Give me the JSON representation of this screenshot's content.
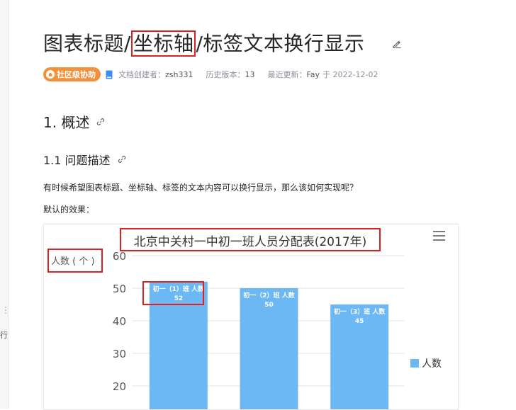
{
  "sidebar": {
    "handle": "⋮",
    "fragment": "行"
  },
  "page": {
    "title_pre": "图表标题/",
    "title_hl": "坐标轴",
    "title_post": "/标签文本换行显示"
  },
  "meta": {
    "badge": "社区级协助",
    "creator_label": "文档创建者：",
    "creator": "zsh331",
    "history_label": "历史版本：",
    "history": "13",
    "updated_label": "最近更新：",
    "updated_by": "Fay",
    "updated_at": "于 2022-12-02"
  },
  "content": {
    "h1": "1. 概述",
    "h2": "1.1 问题描述",
    "p1": "有时候希望图表标题、坐标轴、标签的文本内容可以换行显示，那么该如何实现呢？",
    "p2": "默认的效果："
  },
  "chart_data": {
    "type": "bar",
    "title": "北京中关村一中初一班人员分配表(2017年)",
    "ylabel": "人数 ( 个 )",
    "categories": [
      "初一（1）班",
      "初一（2）班",
      "初一（3）班"
    ],
    "series": [
      {
        "name": "人数",
        "values": [
          52,
          50,
          45
        ]
      }
    ],
    "data_labels": [
      "初一（1）班  人数\n52",
      "初一（2）班  人数\n50",
      "初一（3）班  人数\n45"
    ],
    "yticks": [
      20,
      30,
      40,
      50,
      60
    ],
    "ylim": [
      0,
      60
    ],
    "grid": true,
    "legend": "right",
    "color": "#6cb8f5",
    "menu_icon": "hamburger-menu-icon"
  }
}
